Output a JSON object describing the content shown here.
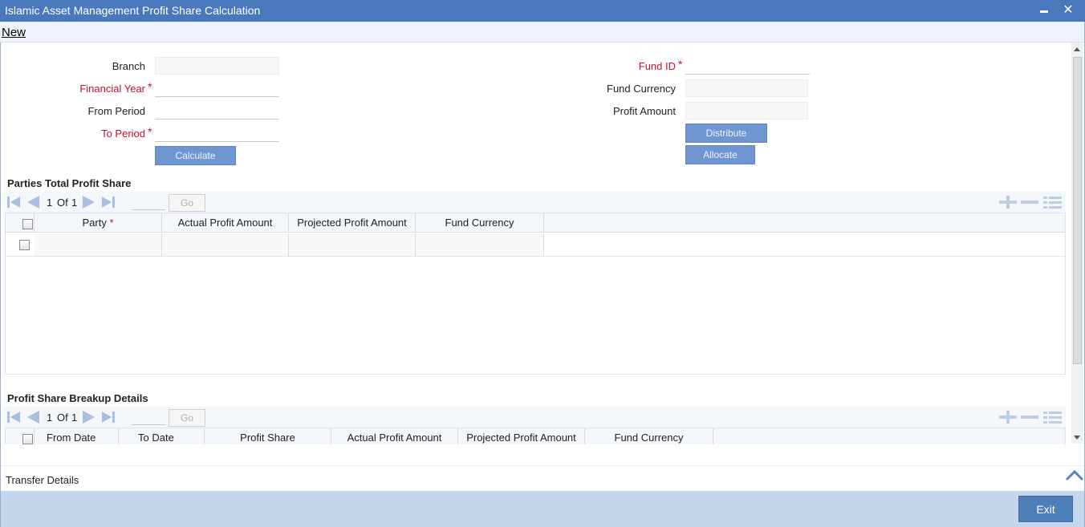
{
  "window": {
    "title": "Islamic Asset Management Profit Share Calculation",
    "minimize_glyph": "▬",
    "close_glyph": "✕"
  },
  "menu": {
    "new_label": "New"
  },
  "form": {
    "branch_label": "Branch",
    "financial_year_label": "Financial Year",
    "from_period_label": "From Period",
    "to_period_label": "To Period",
    "fund_id_label": "Fund ID",
    "fund_currency_label": "Fund Currency",
    "profit_amount_label": "Profit Amount",
    "required_marker": "*",
    "calculate_label": "Calculate",
    "distribute_label": "Distribute",
    "allocate_label": "Allocate"
  },
  "parties_section": {
    "title": "Parties Total Profit Share",
    "pager": {
      "current": "1",
      "of_label": "Of",
      "total": "1",
      "go_label": "Go"
    },
    "columns": [
      "Party",
      "Actual Profit Amount",
      "Projected Profit Amount",
      "Fund Currency"
    ],
    "required_marker": "*"
  },
  "breakup_section": {
    "title": "Profit Share Breakup Details",
    "pager": {
      "current": "1",
      "of_label": "Of",
      "total": "1",
      "go_label": "Go"
    },
    "columns": [
      "From Date",
      "To Date",
      "Profit Share",
      "Actual Profit Amount",
      "Projected Profit Amount",
      "Fund Currency"
    ]
  },
  "transfer": {
    "label": "Transfer Details",
    "chevron_glyph": "︿"
  },
  "footer": {
    "exit_label": "Exit"
  },
  "colors": {
    "titlebar": "#4a78bd",
    "required": "#c8102e",
    "button": "#6f96d0",
    "footer": "#c5d7ed",
    "exit_button": "#4f7fb8"
  }
}
